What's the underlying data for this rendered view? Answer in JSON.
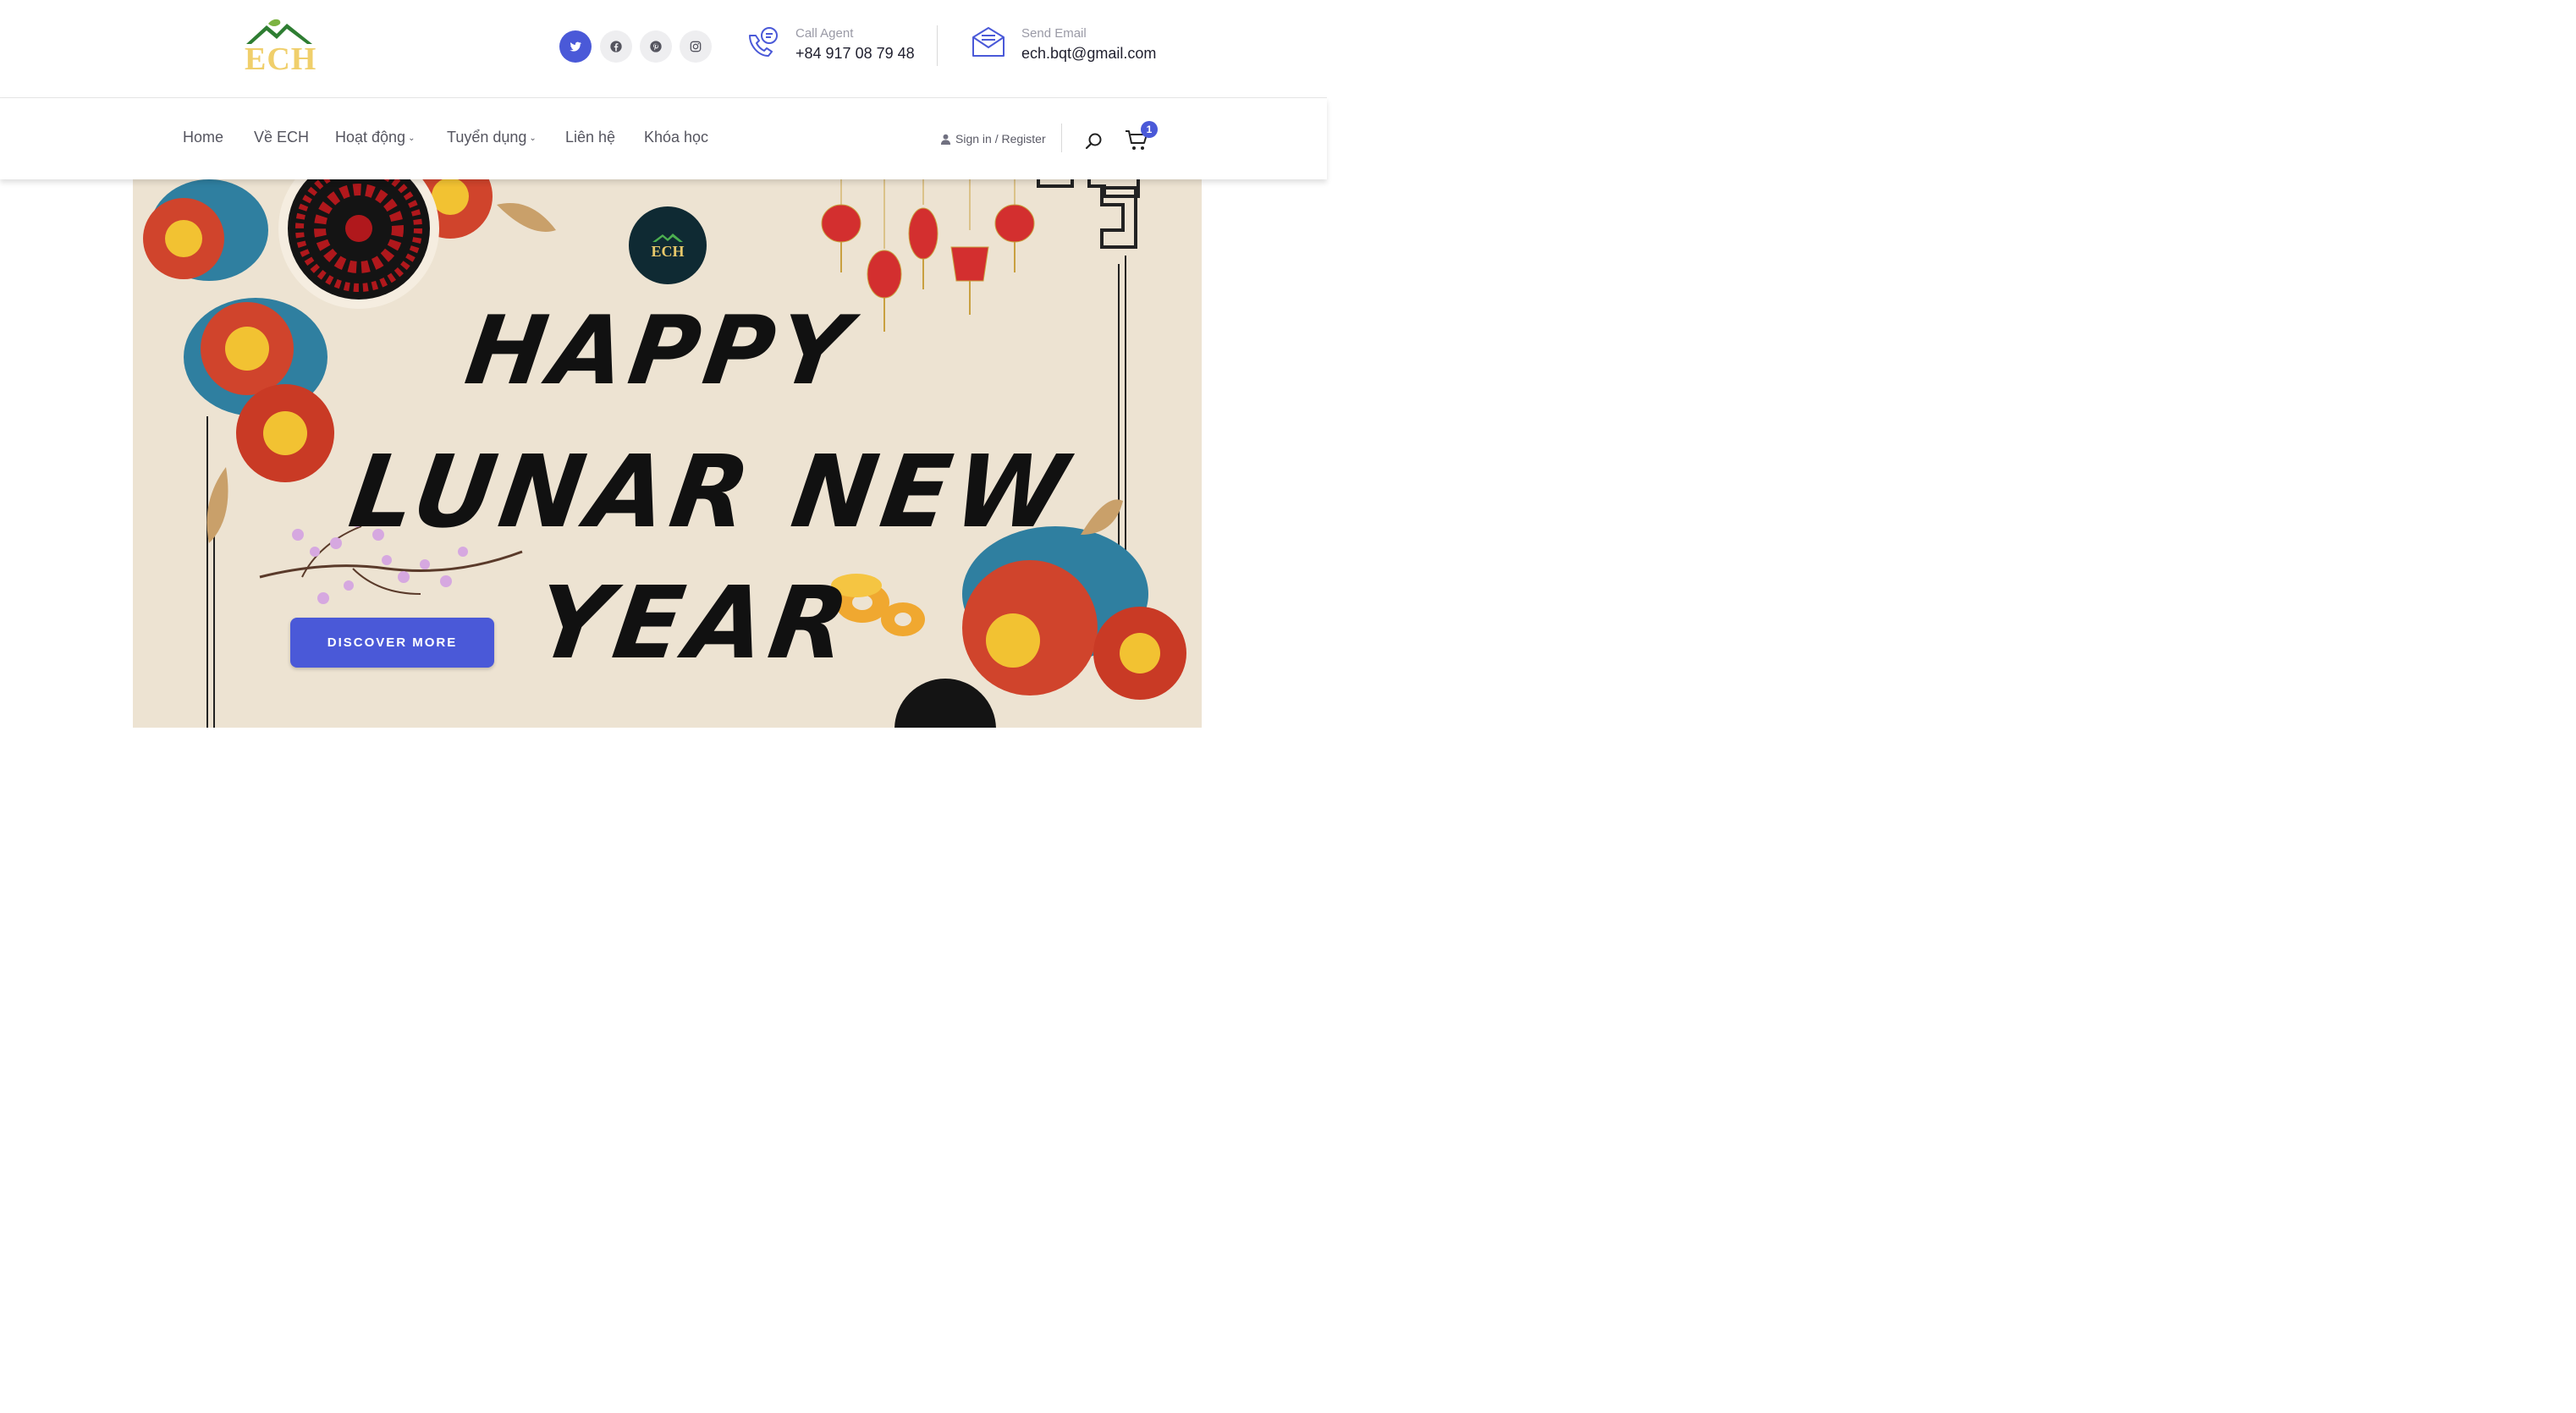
{
  "brand": {
    "logo_text": "ECH",
    "badge_text": "ECH"
  },
  "contact": {
    "call_label": "Call Agent",
    "call_value": "+84 917 08 79 48",
    "email_label": "Send Email",
    "email_value": "ech.bqt@gmail.com"
  },
  "social": [
    {
      "icon": "twitter-icon"
    },
    {
      "icon": "facebook-icon"
    },
    {
      "icon": "pinterest-icon"
    },
    {
      "icon": "instagram-icon"
    }
  ],
  "nav": {
    "items": [
      {
        "label": "Home"
      },
      {
        "label": "Về ECH"
      },
      {
        "label": "Hoạt động",
        "has_dropdown": true
      },
      {
        "label": "Tuyển dụng",
        "has_dropdown": true
      },
      {
        "label": "Liên hệ"
      },
      {
        "label": "Khóa học"
      }
    ],
    "signin_label": "Sign in / Register",
    "cart_count": "1"
  },
  "hero": {
    "line1": "HAPPY",
    "line2": "LUNAR NEW",
    "line3": "YEAR",
    "cta_label": "DISCOVER MORE"
  },
  "colors": {
    "accent": "#4a59d8",
    "hero_bg": "#ede3d2",
    "logo_gold": "#f0cf6b",
    "logo_green": "#2e7d32"
  }
}
